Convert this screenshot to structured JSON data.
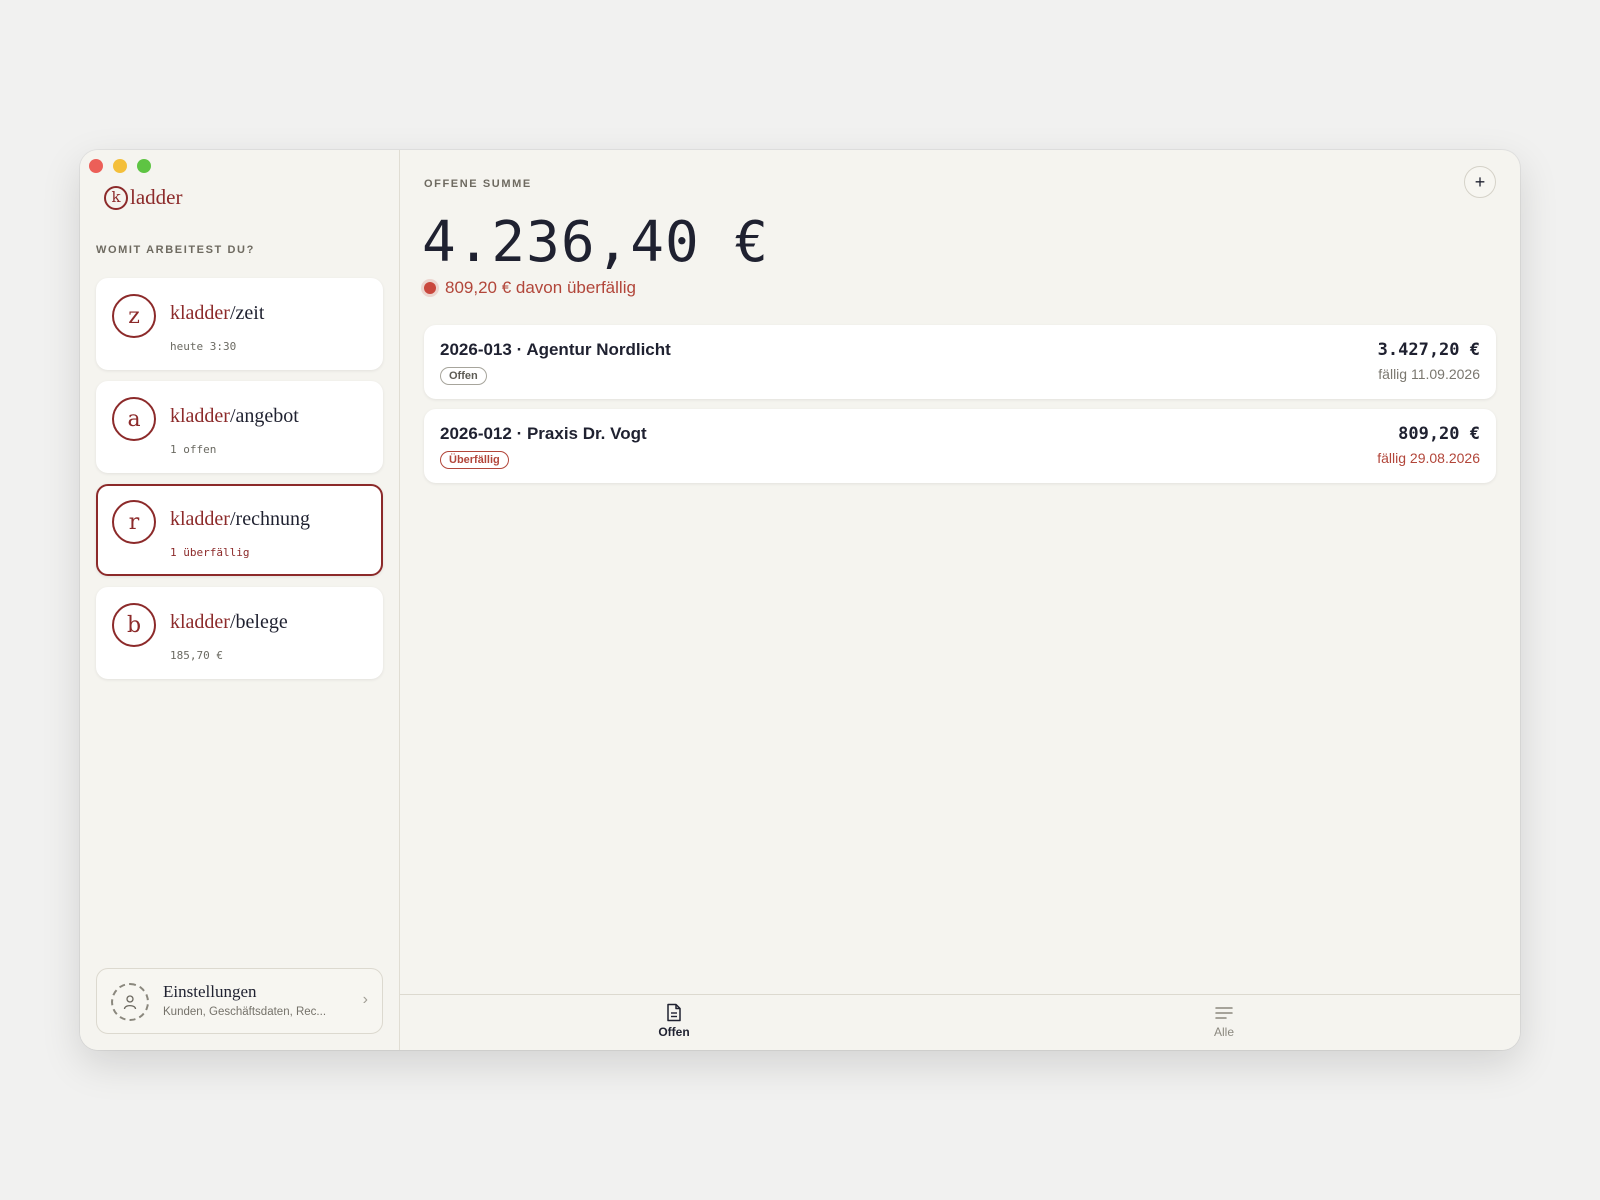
{
  "app": {
    "logo_letter": "k",
    "logo_text": "ladder"
  },
  "sidebar": {
    "section_label": "WOMIT ARBEITEST DU?",
    "items": [
      {
        "letter": "z",
        "prefix": "kladder",
        "suffix": "zeit",
        "sub": "heute 3:30"
      },
      {
        "letter": "a",
        "prefix": "kladder",
        "suffix": "angebot",
        "sub": "1 offen"
      },
      {
        "letter": "r",
        "prefix": "kladder",
        "suffix": "rechnung",
        "sub": "1 überfällig"
      },
      {
        "letter": "b",
        "prefix": "kladder",
        "suffix": "belege",
        "sub": "185,70 €"
      }
    ],
    "separator": "/",
    "settings": {
      "title": "Einstellungen",
      "subtitle": "Kunden, Geschäftsdaten, Rec..."
    }
  },
  "main": {
    "sum_label": "OFFENE SUMME",
    "total": "4.236,40 €",
    "overdue_text": "809,20 € davon überfällig",
    "add_label": "+",
    "invoices": [
      {
        "title": "2026-013 · Agentur Nordlicht",
        "status": "Offen",
        "amount": "3.427,20 €",
        "due": "fällig 11.09.2026"
      },
      {
        "title": "2026-012 · Praxis Dr. Vogt",
        "status": "Überfällig",
        "amount": "809,20 €",
        "due": "fällig 29.08.2026"
      }
    ]
  },
  "tabs": [
    {
      "label": "Offen",
      "icon": "document-icon",
      "active": true
    },
    {
      "label": "Alle",
      "icon": "list-icon",
      "active": false
    }
  ],
  "colors": {
    "accent": "#8c2a2a",
    "overdue": "#b2463a",
    "background": "#f5f4ef"
  }
}
